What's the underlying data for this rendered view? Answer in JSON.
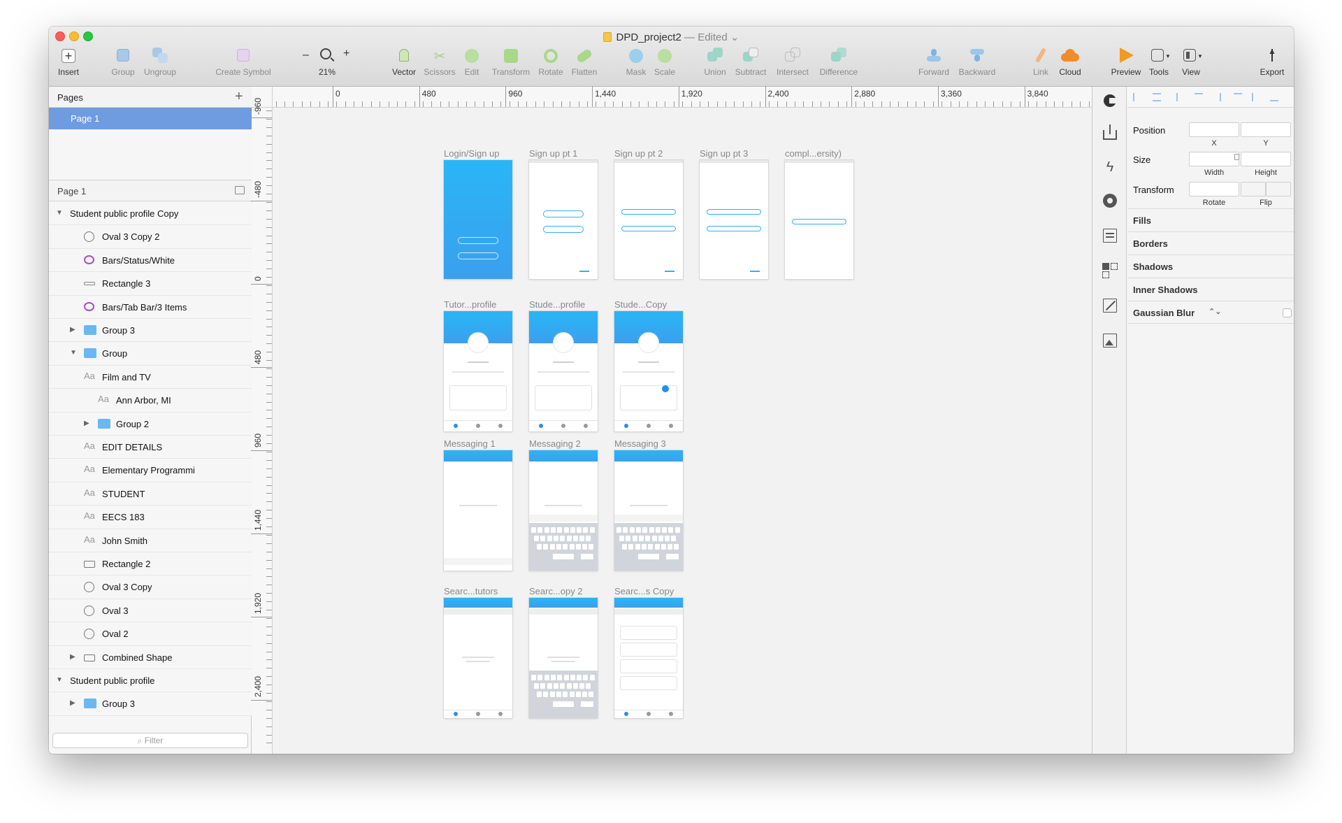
{
  "window": {
    "title": "DPD_project2",
    "edited": "— Edited"
  },
  "toolbar": {
    "insert": "Insert",
    "group": "Group",
    "ungroup": "Ungroup",
    "create_symbol": "Create Symbol",
    "zoom_minus": "–",
    "zoom_plus": "+",
    "zoom_level": "21%",
    "vector": "Vector",
    "scissors": "Scissors",
    "edit": "Edit",
    "transform": "Transform",
    "rotate": "Rotate",
    "flatten": "Flatten",
    "mask": "Mask",
    "scale": "Scale",
    "union": "Union",
    "subtract": "Subtract",
    "intersect": "Intersect",
    "difference": "Difference",
    "forward": "Forward",
    "backward": "Backward",
    "link": "Link",
    "cloud": "Cloud",
    "preview": "Preview",
    "tools": "Tools",
    "view": "View",
    "export": "Export"
  },
  "pages": {
    "header": "Pages",
    "add": "+",
    "items": [
      "Page 1"
    ]
  },
  "layers": {
    "header": "Page 1",
    "items": [
      {
        "label": "Student public profile Copy",
        "type": "artboard",
        "expanded": true
      },
      {
        "label": "Oval 3 Copy 2",
        "type": "oval"
      },
      {
        "label": "Bars/Status/White",
        "type": "symbol"
      },
      {
        "label": "Rectangle 3",
        "type": "line"
      },
      {
        "label": "Bars/Tab Bar/3 Items",
        "type": "symbol"
      },
      {
        "label": "Group 3",
        "type": "folder",
        "expanded": false
      },
      {
        "label": "Group",
        "type": "folder",
        "expanded": true
      },
      {
        "label": "Film and TV",
        "type": "text"
      },
      {
        "label": "Ann Arbor, MI",
        "type": "text"
      },
      {
        "label": "Group 2",
        "type": "folder",
        "expanded": false
      },
      {
        "label": "EDIT DETAILS",
        "type": "text"
      },
      {
        "label": "Elementary Programmi",
        "type": "text"
      },
      {
        "label": "STUDENT",
        "type": "text"
      },
      {
        "label": "EECS 183",
        "type": "text"
      },
      {
        "label": "John Smith",
        "type": "text"
      },
      {
        "label": "Rectangle 2",
        "type": "rect"
      },
      {
        "label": "Oval 3 Copy",
        "type": "oval"
      },
      {
        "label": "Oval 3",
        "type": "oval"
      },
      {
        "label": "Oval 2",
        "type": "oval"
      },
      {
        "label": "Combined Shape",
        "type": "rect",
        "expanded": false
      },
      {
        "label": "Student public profile",
        "type": "artboard",
        "expanded": true
      },
      {
        "label": "Group 3",
        "type": "folder",
        "expanded": false
      }
    ],
    "filter_placeholder": "Filter"
  },
  "ruler": {
    "h_labels": [
      "0",
      "480",
      "960",
      "1,440",
      "1,920",
      "2,400",
      "2,880",
      "3,360",
      "3,840"
    ],
    "v_labels": [
      "-960",
      "-480",
      "0",
      "480",
      "960",
      "1,440",
      "1,920",
      "2,400"
    ]
  },
  "artboards": [
    {
      "title": "Login/Sign up",
      "kind": "login"
    },
    {
      "title": "Sign up pt 1",
      "kind": "signup1"
    },
    {
      "title": "Sign up pt 2",
      "kind": "fields"
    },
    {
      "title": "Sign up pt 3",
      "kind": "fields"
    },
    {
      "title": "compl...ersity)",
      "kind": "field1"
    },
    {
      "title": "Tutor...profile",
      "kind": "profile"
    },
    {
      "title": "Stude...profile",
      "kind": "profile"
    },
    {
      "title": "Stude...Copy",
      "kind": "profile"
    },
    {
      "title": "Messaging 1",
      "kind": "msg"
    },
    {
      "title": "Messaging 2",
      "kind": "msgkb"
    },
    {
      "title": "Messaging 3",
      "kind": "msgkb"
    },
    {
      "title": "Searc...tutors",
      "kind": "search"
    },
    {
      "title": "Searc...opy 2",
      "kind": "searchkb"
    },
    {
      "title": "Searc...s Copy",
      "kind": "results"
    }
  ],
  "inspector": {
    "position": "Position",
    "x": "X",
    "y": "Y",
    "size": "Size",
    "width": "Width",
    "height": "Height",
    "transform": "Transform",
    "rotate": "Rotate",
    "flip": "Flip",
    "fills": "Fills",
    "borders": "Borders",
    "shadows": "Shadows",
    "inner_shadows": "Inner Shadows",
    "gaussian_blur": "Gaussian Blur"
  },
  "colors": {
    "accent": "#6f9be0",
    "brand_blue": "#2ab0f2",
    "folder": "#6bb7f0",
    "symbol": "#a64dc4"
  }
}
